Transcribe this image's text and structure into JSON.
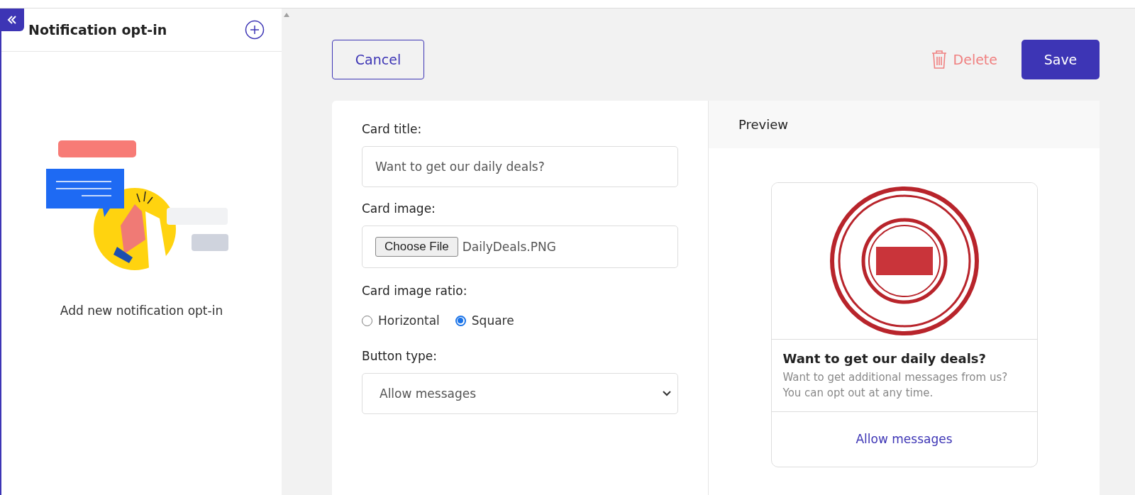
{
  "sidebar": {
    "title": "Notification opt-in",
    "empty_text": "Add new notification opt-in"
  },
  "toolbar": {
    "cancel": "Cancel",
    "delete": "Delete",
    "save": "Save"
  },
  "form": {
    "title_label": "Card title:",
    "title_value": "Want to get our daily deals?",
    "image_label": "Card image:",
    "file_button": "Choose File",
    "file_name": "DailyDeals.PNG",
    "ratio_label": "Card image ratio:",
    "ratio_options": [
      {
        "label": "Horizontal",
        "selected": false
      },
      {
        "label": "Square",
        "selected": true
      }
    ],
    "button_type_label": "Button type:",
    "button_type_value": "Allow messages"
  },
  "preview": {
    "heading": "Preview",
    "card_title": "Want to get our daily deals?",
    "card_text": "Want to get additional messages from us? You can opt out at any time.",
    "card_button": "Allow messages"
  }
}
